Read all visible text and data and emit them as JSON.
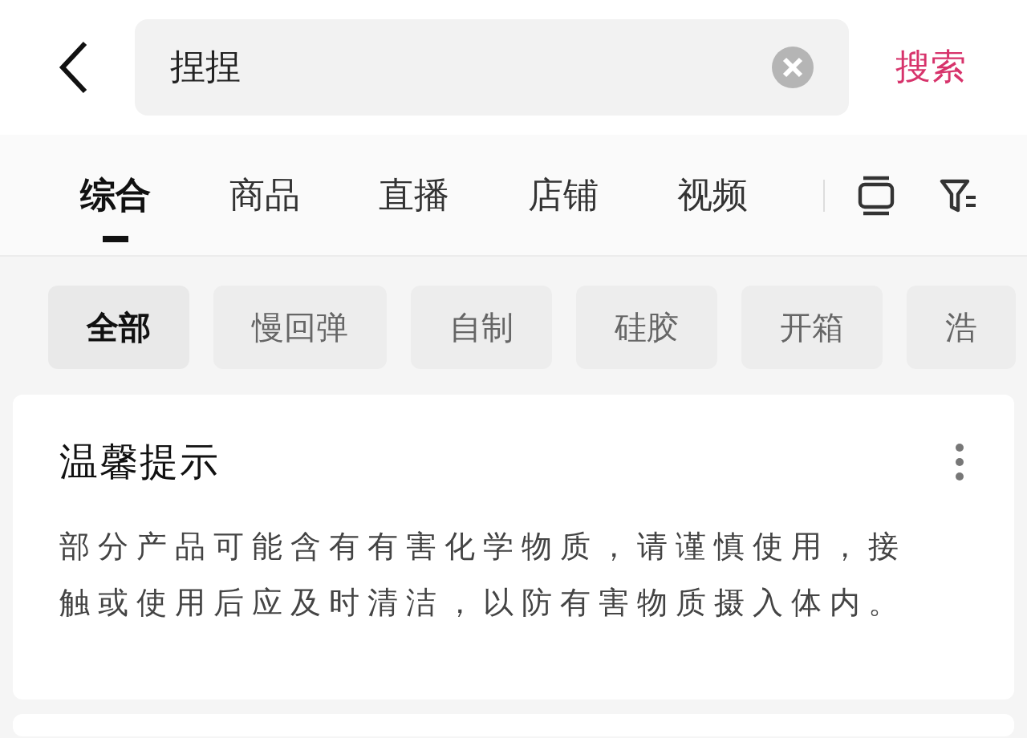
{
  "search": {
    "value": "捏捏",
    "action": "搜索"
  },
  "tabs": [
    {
      "label": "综合",
      "selected": true
    },
    {
      "label": "商品",
      "selected": false
    },
    {
      "label": "直播",
      "selected": false
    },
    {
      "label": "店铺",
      "selected": false
    },
    {
      "label": "视频",
      "selected": false
    }
  ],
  "chips": [
    {
      "label": "全部",
      "selected": true
    },
    {
      "label": "慢回弹",
      "selected": false
    },
    {
      "label": "自制",
      "selected": false
    },
    {
      "label": "硅胶",
      "selected": false
    },
    {
      "label": "开箱",
      "selected": false
    },
    {
      "label": "浩",
      "selected": false
    }
  ],
  "notice": {
    "title": "温馨提示",
    "text": "部分产品可能含有有害化学物质，请谨慎使用，接触或使用后应及时清洁，以防有害物质摄入体内。"
  }
}
